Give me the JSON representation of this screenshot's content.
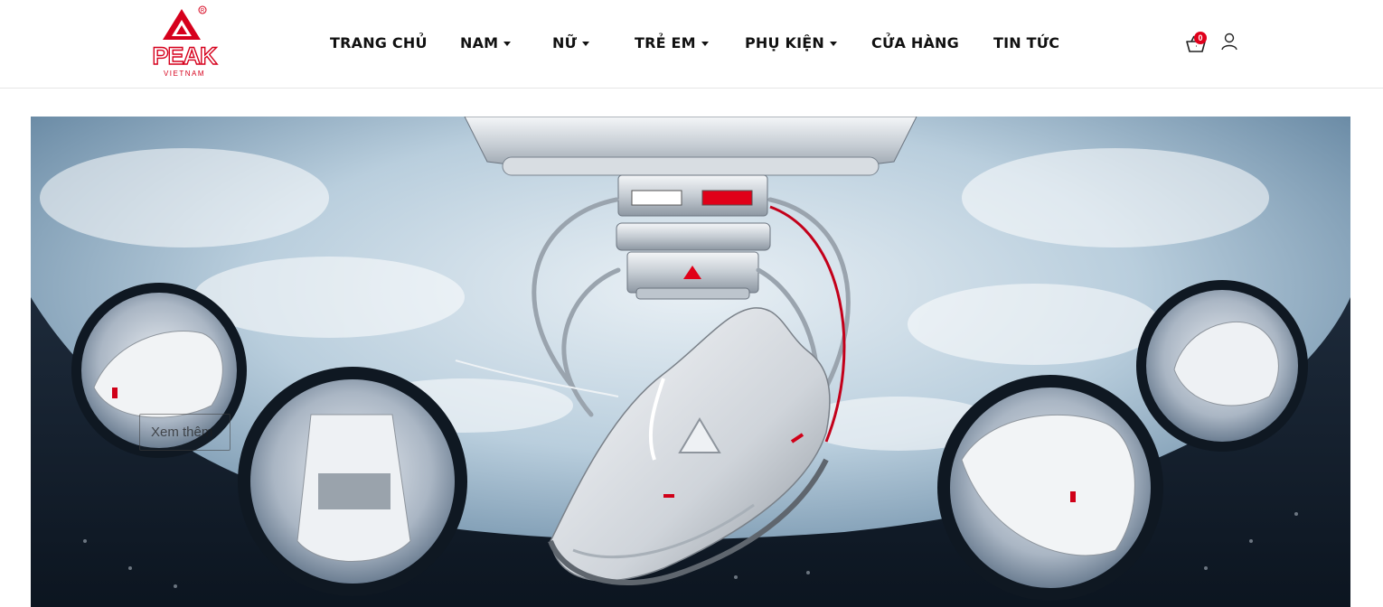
{
  "brand": {
    "name": "PEAK",
    "tagline": "VIETNAM",
    "logo_icon": "peak-triangle-logo-icon",
    "primary_color": "#d6001c"
  },
  "nav": {
    "items": [
      {
        "label": "TRANG CHỦ",
        "has_dropdown": false
      },
      {
        "label": "NAM",
        "has_dropdown": true
      },
      {
        "label": "NỮ",
        "has_dropdown": true
      },
      {
        "label": "TRẺ EM",
        "has_dropdown": true
      },
      {
        "label": "PHỤ KIỆN",
        "has_dropdown": true
      },
      {
        "label": "CỬA HÀNG",
        "has_dropdown": false
      },
      {
        "label": "TIN TỨC",
        "has_dropdown": false
      }
    ]
  },
  "header_actions": {
    "cart_icon": "shopping-basket-icon",
    "cart_count": "0",
    "cart_badge_color": "#e0001b",
    "account_icon": "user-icon"
  },
  "hero": {
    "cta_label": "Xem thêm",
    "image_description_icons": [
      "space-station-window",
      "floating-sneaker",
      "porthole-detail-views"
    ]
  }
}
